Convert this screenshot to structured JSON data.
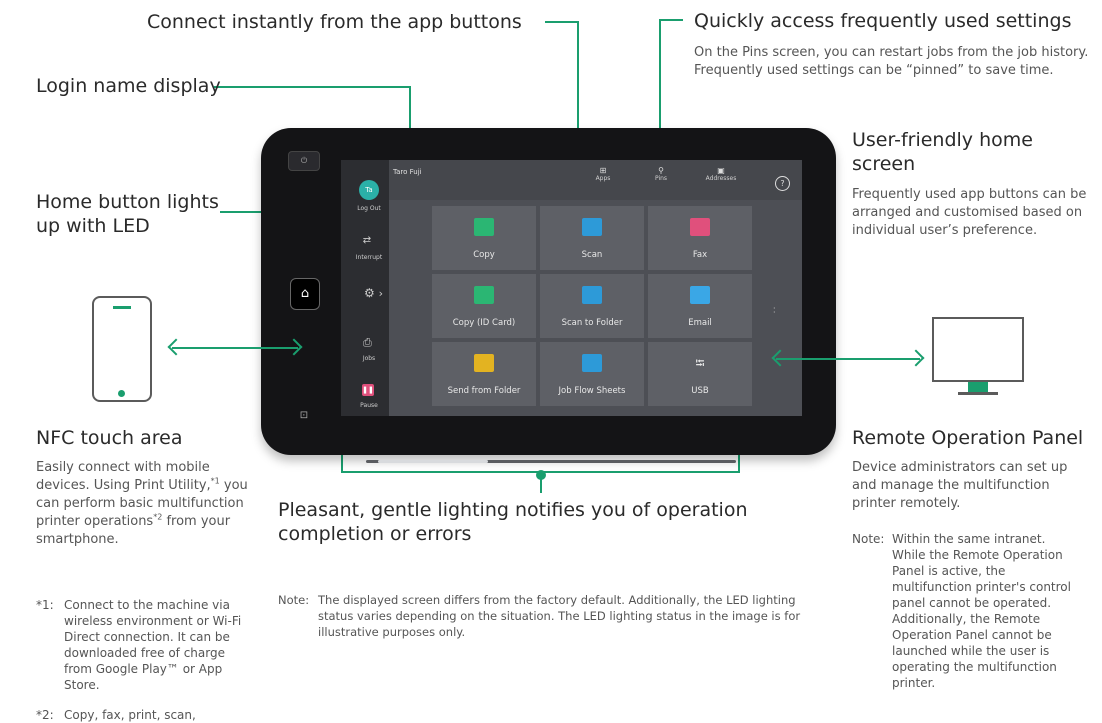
{
  "callouts": {
    "connect_apps": "Connect instantly from the app buttons",
    "login": "Login name display",
    "home_led": "Home button lights up with LED",
    "settings": {
      "title": "Quickly access frequently used settings",
      "body": "On the Pins screen, you can restart jobs from the job history. Frequently used settings can be “pinned” to save time."
    },
    "home_screen": {
      "title": "User-friendly home screen",
      "body": "Frequently used app buttons can be arranged and customised based on individual user’s preference."
    },
    "nfc": {
      "title": "NFC touch area",
      "body_a": "Easily connect with mobile devices. Using Print Utility,",
      "sup1": "*1",
      "body_b": " you can perform basic multifunction printer operations",
      "sup2": "*2",
      "body_c": " from your smartphone.",
      "fn1_mark": "*1:",
      "fn1_text": "Connect to the machine via wireless environment or Wi-Fi Direct connection. It can be downloaded free of charge from Google Play™ or App Store.",
      "fn2_mark": "*2:",
      "fn2_text": "Copy, fax, print, scan,"
    },
    "remote": {
      "title": "Remote Operation Panel",
      "body": "Device administrators can set up and manage the multifunction printer remotely.",
      "note_mark": "Note:",
      "note_text": "Within the same intranet. While the Remote Operation Panel is active, the multifunction printer's control panel cannot be operated. Additionally, the Remote Operation Panel cannot be launched while the user is operating the multifunction printer."
    },
    "lighting": "Pleasant, gentle lighting notifies you of operation completion or errors",
    "note_bottom_mark": "Note:",
    "note_bottom_text": "The displayed screen differs from the factory default. Additionally, the LED lighting status varies depending on the situation. The LED lighting status in the image is for illustrative purposes only."
  },
  "screen": {
    "login_name": "Taro Fuji",
    "avatar": "Ta",
    "sidebar": [
      {
        "label": "Log Out"
      },
      {
        "label": "Interrupt"
      },
      {
        "label": "Jobs"
      },
      {
        "label": "Pause"
      }
    ],
    "top_tabs": [
      {
        "label": "Apps"
      },
      {
        "label": "Pins"
      },
      {
        "label": "Addresses"
      }
    ],
    "help_glyph": "?",
    "apps": [
      {
        "label": "Copy",
        "color": "#2bb673"
      },
      {
        "label": "Scan",
        "color": "#2d9ad8"
      },
      {
        "label": "Fax",
        "color": "#e0507c"
      },
      {
        "label": "Copy (ID Card)",
        "color": "#2bb673"
      },
      {
        "label": "Scan to Folder",
        "color": "#2d9ad8"
      },
      {
        "label": "Email",
        "color": "#3aa7e6"
      },
      {
        "label": "Send from Folder",
        "color": "#e3b321"
      },
      {
        "label": "Job Flow Sheets",
        "color": "#2d9ad8"
      },
      {
        "label": "USB",
        "color": "#e8e8e8"
      }
    ]
  },
  "colors": {
    "accent": "#1a9e6e",
    "pause": "#e0507c",
    "avatar": "#2bb0a8"
  }
}
